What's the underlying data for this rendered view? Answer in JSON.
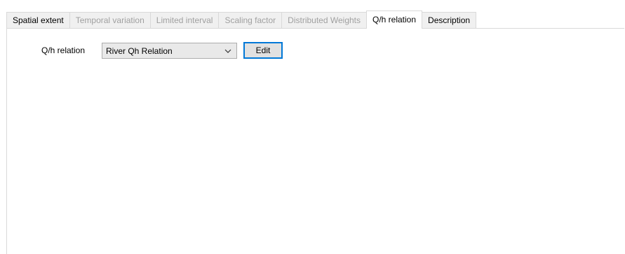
{
  "tabs": [
    {
      "label": "Spatial extent",
      "state": "enabled"
    },
    {
      "label": "Temporal variation",
      "state": "disabled"
    },
    {
      "label": "Limited interval",
      "state": "disabled"
    },
    {
      "label": "Scaling factor",
      "state": "disabled"
    },
    {
      "label": "Distributed Weights",
      "state": "disabled"
    },
    {
      "label": "Q/h relation",
      "state": "active"
    },
    {
      "label": "Description",
      "state": "enabled"
    }
  ],
  "qh_panel": {
    "field_label": "Q/h relation",
    "selected_value": "River Qh Relation",
    "edit_label": "Edit"
  },
  "colors": {
    "focus_border": "#0078d7",
    "disabled_text": "#a0a0a0",
    "tab_border": "#d9d9d9"
  },
  "icons": {
    "dropdown": "chevron-down-icon"
  }
}
